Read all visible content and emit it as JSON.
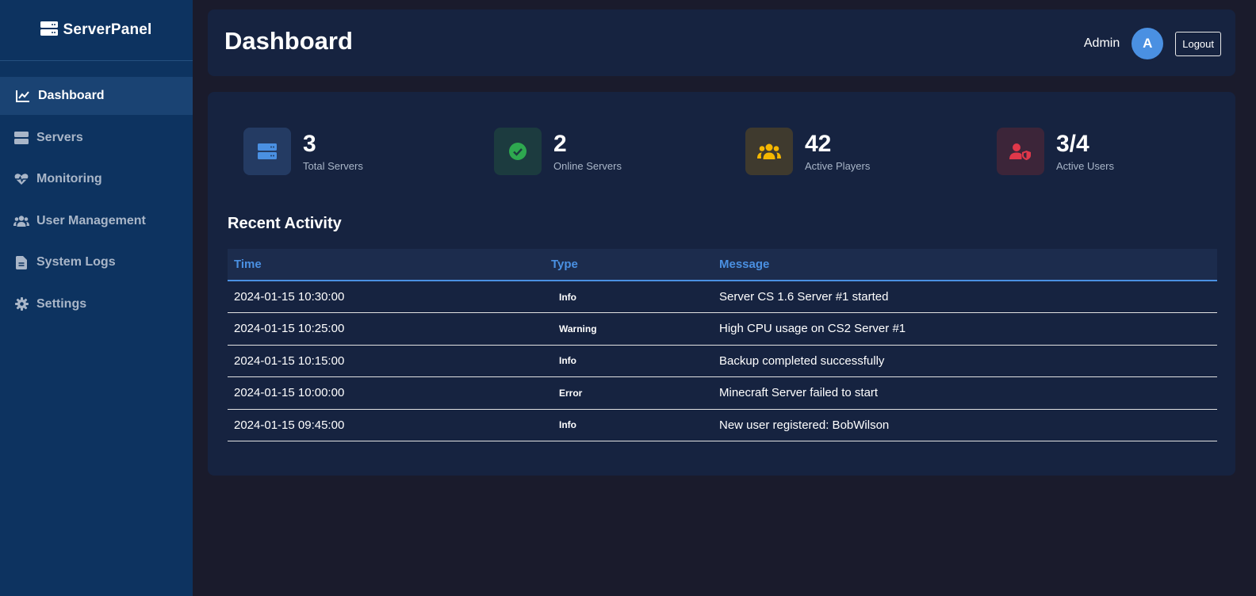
{
  "brand": {
    "name": "ServerPanel",
    "icon": "server-icon"
  },
  "sidebar": {
    "items": [
      {
        "label": "Dashboard",
        "icon": "chart-line-icon",
        "active": true
      },
      {
        "label": "Servers",
        "icon": "server-icon",
        "active": false
      },
      {
        "label": "Monitoring",
        "icon": "heartbeat-icon",
        "active": false
      },
      {
        "label": "User Management",
        "icon": "users-icon",
        "active": false
      },
      {
        "label": "System Logs",
        "icon": "file-icon",
        "active": false
      },
      {
        "label": "Settings",
        "icon": "gear-icon",
        "active": false
      }
    ]
  },
  "header": {
    "title": "Dashboard",
    "user_name": "Admin",
    "avatar_initial": "A",
    "logout_label": "Logout"
  },
  "stats": [
    {
      "value": "3",
      "label": "Total Servers",
      "icon": "server-icon",
      "color": "#4a90e2"
    },
    {
      "value": "2",
      "label": "Online Servers",
      "icon": "check-circle-icon",
      "color": "#2ea84f"
    },
    {
      "value": "42",
      "label": "Active Players",
      "icon": "users-icon",
      "color": "#f5b700"
    },
    {
      "value": "3/4",
      "label": "Active Users",
      "icon": "user-shield-icon",
      "color": "#e0384a"
    }
  ],
  "activity": {
    "title": "Recent Activity",
    "columns": [
      "Time",
      "Type",
      "Message"
    ],
    "rows": [
      {
        "time": "2024-01-15 10:30:00",
        "type": "Info",
        "message": "Server CS 1.6 Server #1 started"
      },
      {
        "time": "2024-01-15 10:25:00",
        "type": "Warning",
        "message": "High CPU usage on CS2 Server #1"
      },
      {
        "time": "2024-01-15 10:15:00",
        "type": "Info",
        "message": "Backup completed successfully"
      },
      {
        "time": "2024-01-15 10:00:00",
        "type": "Error",
        "message": "Minecraft Server failed to start"
      },
      {
        "time": "2024-01-15 09:45:00",
        "type": "Info",
        "message": "New user registered: BobWilson"
      }
    ]
  },
  "colors": {
    "accent": "#4a90e2",
    "sidebar_bg": "#0d3360",
    "card_bg": "#162340",
    "page_bg": "#1a1b2c"
  }
}
